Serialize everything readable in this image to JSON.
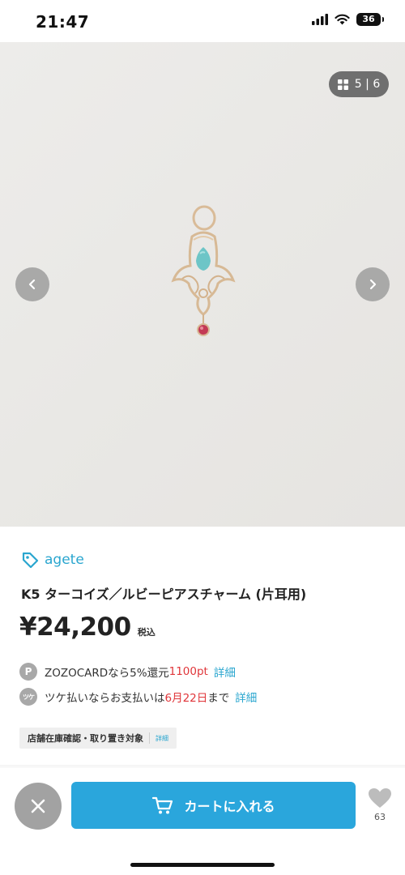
{
  "status_bar": {
    "time": "21:47",
    "battery": "36"
  },
  "gallery": {
    "current": "5",
    "total": "6",
    "separator": "|"
  },
  "product": {
    "brand": "agete",
    "title": "K5 ターコイズ／ルビーピアスチャーム (片耳用)",
    "price": "¥24,200",
    "tax_label": "税込"
  },
  "benefits": {
    "zozocard": {
      "icon_letter": "P",
      "text": "ZOZOCARDなら5%還元 ",
      "points": "1100pt",
      "link": "詳細"
    },
    "tsuke": {
      "icon_letter": "ツケ",
      "text_before": "ツケ払いならお支払いは",
      "date": "6月22日",
      "text_after": "まで",
      "link": "詳細"
    }
  },
  "stock_badge": {
    "label": "店舗在庫確認・取り置き対象",
    "detail": "詳細"
  },
  "bottom_bar": {
    "cart_label": "カートに入れる",
    "favorite_count": "63"
  },
  "colors": {
    "accent": "#2aa6dc",
    "brand_text": "#2aa6cf",
    "highlight_red": "#e0363a",
    "gray_button": "#a2a2a2"
  }
}
